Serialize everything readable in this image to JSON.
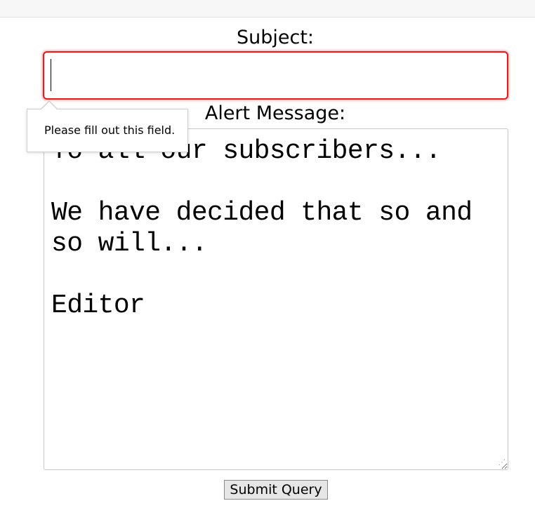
{
  "form": {
    "subject_label": "Subject:",
    "subject_value": "",
    "alert_label": "Alert Message:",
    "message_value": "To all our subscribers...\n\nWe have decided that so and so will...\n\nEditor",
    "submit_label": "Submit Query"
  },
  "validation": {
    "tooltip_text": "Please fill out this field.",
    "error_color": "#e81c1c"
  }
}
